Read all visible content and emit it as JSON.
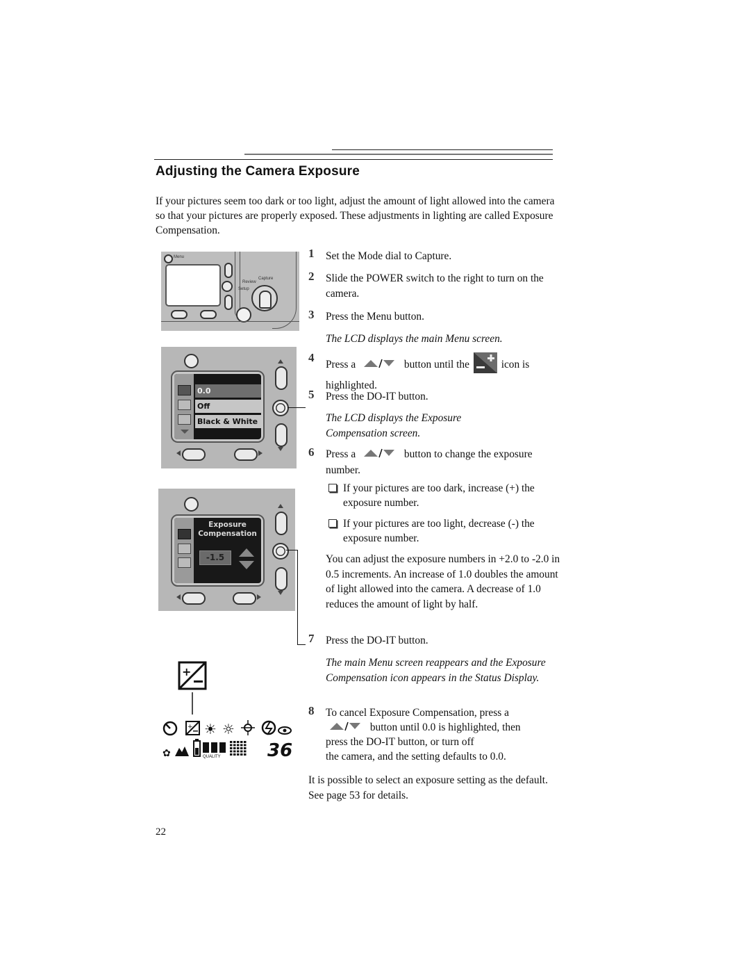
{
  "page": {
    "title": "Adjusting the Camera Exposure",
    "intro": "If your pictures seem too dark or too light, adjust the amount of light allowed into the camera so that your pictures are properly exposed. These adjustments in lighting are called Exposure Compensation.",
    "page_number": "22"
  },
  "steps": [
    {
      "num": "1",
      "text": "Set the Mode dial to Capture."
    },
    {
      "num": "2",
      "text": "Slide the POWER switch to the right to turn on the camera."
    },
    {
      "num": "3",
      "text": "Press the Menu button.",
      "result": "The LCD displays the main Menu screen."
    },
    {
      "num": "4",
      "pre": "Press a",
      "mid": "button until the",
      "post": "icon is highlighted."
    },
    {
      "num": "5",
      "text": "Press the DO-IT button.",
      "result": "The LCD displays the Exposure Compensation screen."
    },
    {
      "num": "6",
      "pre": "Press a",
      "post": "button to change the exposure number."
    },
    {
      "num": "7",
      "text": "Press the DO-IT button.",
      "result": "The main Menu screen reappears and the Exposure Compensation icon appears in the Status Display."
    },
    {
      "num": "8",
      "line1": "To cancel Exposure Compensation, press a",
      "line2": "button until 0.0 is highlighted, then",
      "line3": "press the DO-IT button, or turn off",
      "line4": "the camera, and the setting defaults to 0.0."
    }
  ],
  "bullets": [
    "If your pictures are too dark, increase (+) the exposure number.",
    "If your pictures are too light, decrease (-) the exposure number."
  ],
  "note_step6": "You can adjust the exposure numbers in +2.0 to -2.0 in 0.5 increments. An increase of 1.0 doubles the amount of light allowed into the camera. A decrease of 1.0 reduces the amount of light by half.",
  "closing": "It is possible to select an exposure setting as the default. See page 53 for details.",
  "figure1": {
    "menu_label": "Menu",
    "mode_labels": {
      "capture": "Capture",
      "review": "Review",
      "setup": "Setup"
    }
  },
  "figure2": {
    "menu_rows": [
      "0.0",
      "Off",
      "Black & White"
    ]
  },
  "figure3": {
    "title_line1": "Exposure",
    "title_line2": "Compensation",
    "value": "-1.5"
  },
  "figure4": {
    "quality_label": "QUALITY",
    "shots_remaining": "36"
  }
}
